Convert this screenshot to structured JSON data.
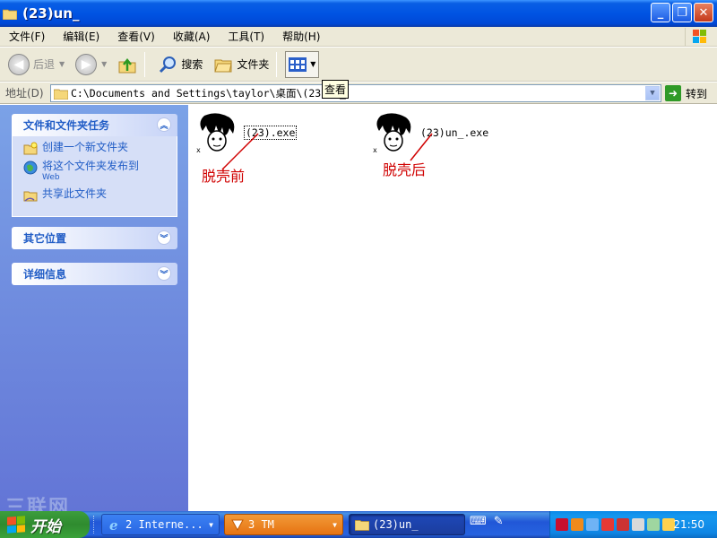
{
  "window": {
    "title": "(23)un_"
  },
  "menu": [
    "文件(F)",
    "编辑(E)",
    "查看(V)",
    "收藏(A)",
    "工具(T)",
    "帮助(H)"
  ],
  "toolbar": {
    "back": "后退",
    "search": "搜索",
    "folders": "文件夹"
  },
  "address": {
    "label": "地址(D)",
    "path": "C:\\Documents and Settings\\taylor\\桌面\\(23)un_",
    "go": "转到"
  },
  "tooltip": "查看",
  "taskpane": {
    "file_tasks": {
      "title": "文件和文件夹任务",
      "items": [
        {
          "label": "创建一个新文件夹"
        },
        {
          "label": "将这个文件夹发布到",
          "sub": "Web"
        },
        {
          "label": "共享此文件夹"
        }
      ]
    },
    "other_places": {
      "title": "其它位置"
    },
    "details": {
      "title": "详细信息"
    }
  },
  "files": [
    {
      "name": "(23).exe",
      "badge": "x",
      "note": "脱壳前"
    },
    {
      "name": "(23)un_.exe",
      "badge": "x",
      "note": "脱壳后"
    }
  ],
  "taskbar": {
    "start": "开始",
    "buttons": [
      "2 Interne...",
      "3 TM",
      "(23)un_"
    ],
    "clock": "21:50",
    "watermark": "三联网"
  },
  "colors": {
    "accent": "#0054e3",
    "note_red": "#d00000",
    "pane_blue": "#7ba2e7"
  }
}
